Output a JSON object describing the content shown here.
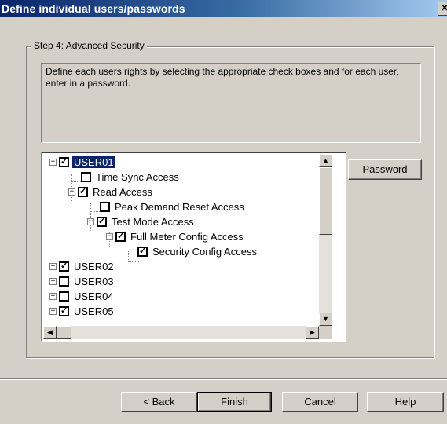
{
  "window": {
    "title": "Define individual users/passwords",
    "close_glyph": "✕"
  },
  "group": {
    "legend": "Step 4: Advanced Security"
  },
  "description": "Define each users rights by selecting the appropriate check boxes and for each user, enter in a password.",
  "password_button": "Password",
  "tree": {
    "items": [
      {
        "label": "USER01",
        "checked": true,
        "expander": "−",
        "selected": true
      },
      {
        "label": "Time Sync Access",
        "checked": false
      },
      {
        "label": "Read Access",
        "checked": true,
        "expander": "−"
      },
      {
        "label": "Peak Demand Reset Access",
        "checked": false
      },
      {
        "label": "Test Mode Access",
        "checked": true,
        "expander": "−"
      },
      {
        "label": "Full Meter Config Access",
        "checked": true,
        "expander": "−"
      },
      {
        "label": "Security Config Access",
        "checked": true
      },
      {
        "label": "USER02",
        "checked": true,
        "expander": "+"
      },
      {
        "label": "USER03",
        "checked": false,
        "expander": "+"
      },
      {
        "label": "USER04",
        "checked": false,
        "expander": "+"
      },
      {
        "label": "USER05",
        "checked": true,
        "expander": "+"
      }
    ],
    "check_glyph": "✓"
  },
  "scroll_glyphs": {
    "up": "▲",
    "down": "▼",
    "left": "◀",
    "right": "▶"
  },
  "footer": {
    "back": "< Back",
    "finish": "Finish",
    "cancel": "Cancel",
    "help": "Help"
  },
  "colors": {
    "title_bar": "#0a246a",
    "selection": "#0a246a",
    "face": "#d4d0c8"
  }
}
